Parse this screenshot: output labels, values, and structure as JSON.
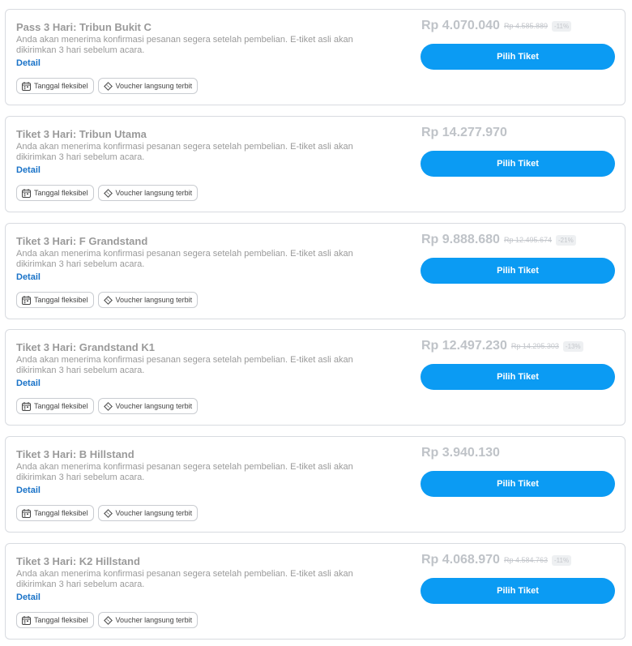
{
  "common": {
    "description": "Anda akan menerima konfirmasi pesanan segera setelah pembelian. E-tiket asli akan dikirimkan 3 hari sebelum acara.",
    "detail_label": "Detail",
    "badge_flexible": "Tanggal fleksibel",
    "badge_voucher": "Voucher langsung terbit",
    "button_label": "Pilih Tiket",
    "calendar_icon": "calendar-icon",
    "ticket_icon": "ticket-icon",
    "accent_color": "#0b9bf3",
    "link_color": "#1a73c8"
  },
  "tickets": [
    {
      "title": "Pass 3 Hari: Tribun Bukit C",
      "price": "Rp 4.070.040",
      "original_price": "Rp 4.585.889",
      "discount": "-11%"
    },
    {
      "title": "Tiket 3 Hari: Tribun Utama",
      "price": "Rp 14.277.970",
      "original_price": "",
      "discount": ""
    },
    {
      "title": "Tiket 3 Hari: F Grandstand",
      "price": "Rp 9.888.680",
      "original_price": "Rp 12.495.674",
      "discount": "-21%"
    },
    {
      "title": "Tiket 3 Hari: Grandstand K1",
      "price": "Rp 12.497.230",
      "original_price": "Rp 14.295.303",
      "discount": "-13%"
    },
    {
      "title": "Tiket 3 Hari: B Hillstand",
      "price": "Rp 3.940.130",
      "original_price": "",
      "discount": ""
    },
    {
      "title": "Tiket 3 Hari: K2 Hillstand",
      "price": "Rp 4.068.970",
      "original_price": "Rp 4.584.763",
      "discount": "-11%"
    }
  ]
}
